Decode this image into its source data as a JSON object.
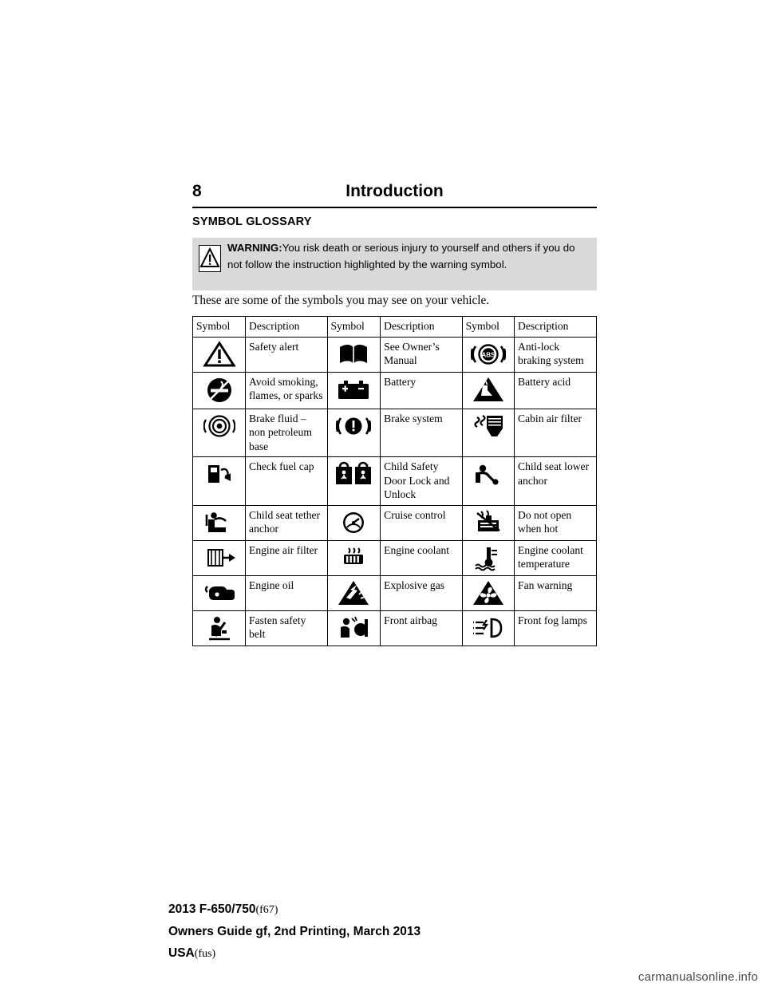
{
  "header": {
    "page_number": "8",
    "title": "Introduction"
  },
  "section": {
    "title": "SYMBOL GLOSSARY"
  },
  "warning": {
    "label": "WARNING:",
    "text": "You risk death or serious injury to yourself and others if you do not follow the instruction highlighted by the warning symbol.",
    "icon": "warning-triangle-icon",
    "background": "#d9d9d9"
  },
  "intro_text": "These are some of the symbols you may see on your vehicle.",
  "table": {
    "headers": [
      "Symbol",
      "Description",
      "Symbol",
      "Description",
      "Symbol",
      "Description"
    ],
    "rows": [
      [
        {
          "icon": "safety-alert-icon",
          "label": "Safety alert"
        },
        {
          "icon": "owners-manual-icon",
          "label": "See Owner’s Manual"
        },
        {
          "icon": "anti-lock-braking-icon",
          "label": "Anti-lock braking system"
        }
      ],
      [
        {
          "icon": "no-smoking-icon",
          "label": "Avoid smoking, flames, or sparks"
        },
        {
          "icon": "battery-icon",
          "label": "Battery"
        },
        {
          "icon": "battery-acid-icon",
          "label": "Battery acid"
        }
      ],
      [
        {
          "icon": "brake-fluid-icon",
          "label": "Brake fluid – non petroleum base"
        },
        {
          "icon": "brake-system-icon",
          "label": "Brake system"
        },
        {
          "icon": "cabin-air-filter-icon",
          "label": "Cabin air filter"
        }
      ],
      [
        {
          "icon": "check-fuel-cap-icon",
          "label": "Check fuel cap"
        },
        {
          "icon": "child-safety-door-lock-icon",
          "label": "Child Safety Door Lock and Unlock"
        },
        {
          "icon": "child-seat-lower-anchor-icon",
          "label": "Child seat lower anchor"
        }
      ],
      [
        {
          "icon": "child-seat-tether-anchor-icon",
          "label": "Child seat tether anchor"
        },
        {
          "icon": "cruise-control-icon",
          "label": "Cruise control"
        },
        {
          "icon": "do-not-open-when-hot-icon",
          "label": "Do not open when hot"
        }
      ],
      [
        {
          "icon": "engine-air-filter-icon",
          "label": "Engine air filter"
        },
        {
          "icon": "engine-coolant-icon",
          "label": "Engine coolant"
        },
        {
          "icon": "engine-coolant-temperature-icon",
          "label": "Engine coolant temperature"
        }
      ],
      [
        {
          "icon": "engine-oil-icon",
          "label": "Engine oil"
        },
        {
          "icon": "explosive-gas-icon",
          "label": "Explosive gas"
        },
        {
          "icon": "fan-warning-icon",
          "label": "Fan warning"
        }
      ],
      [
        {
          "icon": "fasten-safety-belt-icon",
          "label": "Fasten safety belt"
        },
        {
          "icon": "front-airbag-icon",
          "label": "Front airbag"
        },
        {
          "icon": "front-fog-lamps-icon",
          "label": "Front fog lamps"
        }
      ]
    ]
  },
  "footer": {
    "line1_bold": "2013 F-650/750",
    "line1_light": "(f67)",
    "line2": "Owners Guide gf, 2nd Printing, March 2013",
    "line3_bold": "USA",
    "line3_light": "(fus)"
  },
  "watermark": "carmanualsonline.info"
}
